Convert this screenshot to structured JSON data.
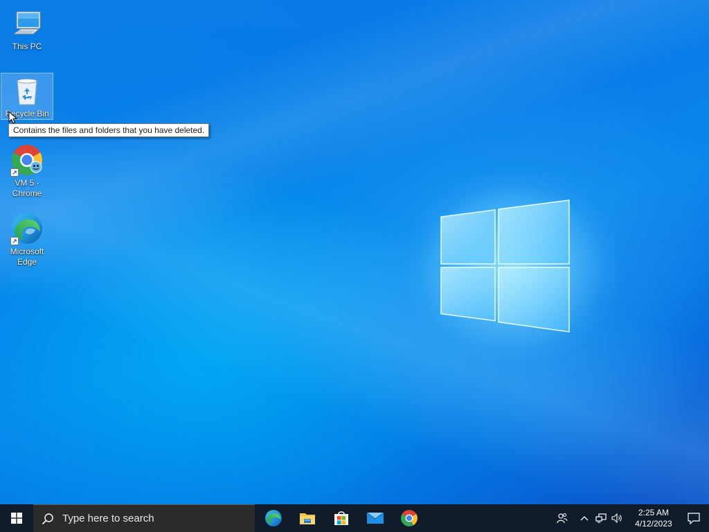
{
  "desktop": {
    "icons": [
      {
        "label": "This PC",
        "icon": "computer-icon"
      },
      {
        "label": "Recycle Bin",
        "icon": "recycle-bin-icon"
      },
      {
        "label": "VM 5 - Chrome",
        "icon": "chrome-icon"
      },
      {
        "label": "Microsoft Edge",
        "icon": "edge-icon"
      }
    ],
    "tooltip": "Contains the files and folders that you have deleted."
  },
  "taskbar": {
    "search_placeholder": "Type here to search",
    "pinned": [
      "edge-icon",
      "file-explorer-icon",
      "microsoft-store-icon",
      "mail-icon",
      "chrome-icon"
    ],
    "tray": [
      "people-icon",
      "chevron-up-icon",
      "network-icon",
      "volume-icon"
    ],
    "clock": {
      "time": "2:25 AM",
      "date": "4/12/2023"
    }
  },
  "colors": {
    "taskbar": "#101c2c",
    "search_box": "#2b2b2b",
    "accent": "#0078d7"
  }
}
